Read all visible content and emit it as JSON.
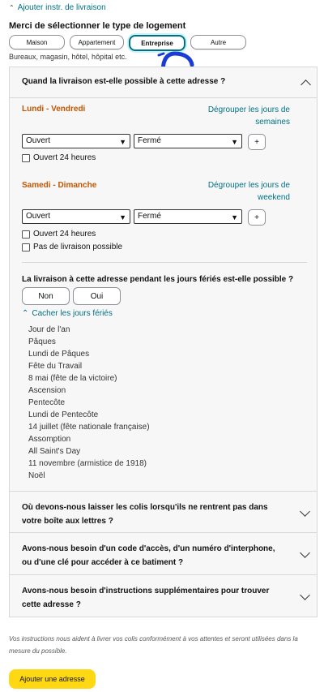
{
  "top_link": "Ajouter instr. de livraison",
  "housing": {
    "title": "Merci de sélectionner le type de logement",
    "types": [
      "Maison",
      "Appartement",
      "Entreprise",
      "Autre"
    ],
    "selected": "Entreprise",
    "description": "Bureaux, magasin, hôtel, hôpital etc."
  },
  "availability": {
    "question": "Quand la livraison est-elle possible à cette adresse ?",
    "weekdays": {
      "label": "Lundi - Vendredi",
      "regroup": "Dégrouper les jours de semaines",
      "open_value": "Ouvert",
      "close_value": "Fermé",
      "plus": "+",
      "open24": "Ouvert 24 heures"
    },
    "weekend": {
      "label": "Samedi - Dimanche",
      "regroup": "Dégrouper les jours de weekend",
      "open_value": "Ouvert",
      "close_value": "Fermé",
      "plus": "+",
      "open24": "Ouvert 24 heures",
      "no_delivery": "Pas de livraison possible"
    },
    "holiday_question": "La livraison à cette adresse pendant les jours fériés est-elle possible ?",
    "no_label": "Non",
    "yes_label": "Oui",
    "hide_holidays": "Cacher les jours fériés",
    "holidays": [
      "Jour de l'an",
      "Pâques",
      "Lundi de Pâques",
      "Fête du Travail",
      "8 mai (fête de la victoire)",
      "Ascension",
      "Pentecôte",
      "Lundi de Pentecôte",
      "14 juillet (fête nationale française)",
      "Assomption",
      "All Saint's Day",
      "11 novembre (armistice de 1918)",
      "Noël"
    ]
  },
  "questions": [
    "Où devons-nous laisser les colis lorsqu'ils ne rentrent pas dans votre boîte aux lettres ?",
    "Avons-nous besoin d'un code d'accès, d'un numéro d'interphone, ou d'une clé pour accéder à ce batiment ?",
    "Avons-nous besoin d'instructions supplémentaires pour trouver cette adresse ?"
  ],
  "footnote": "Vos instructions nous aident à livrer vos colis conformément à vos attentes et seront utilisées dans la mesure du possible.",
  "add_button": "Ajouter une adresse",
  "colors": {
    "accent": "#007185",
    "orange": "#c45500",
    "button": "#ffd814",
    "annotation": "#1a3bd6"
  }
}
